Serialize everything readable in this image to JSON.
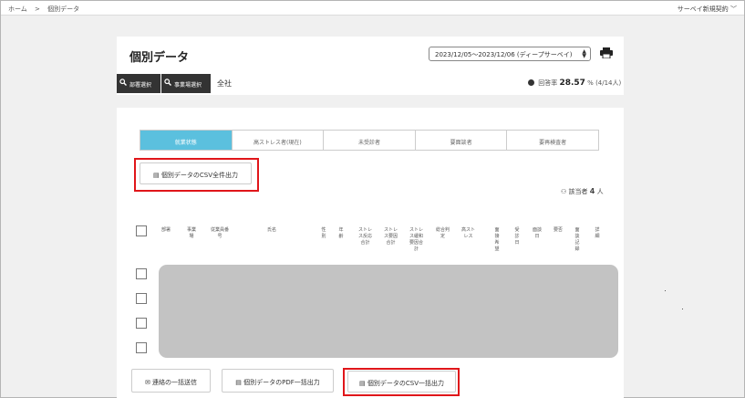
{
  "breadcrumb": [
    "ホーム",
    ">",
    "個別データ"
  ],
  "topbar": {
    "right_link": "サーベイ新規契約",
    "chevron": "chevron-down-icon"
  },
  "header": {
    "title": "個別データ",
    "period": "2023/12/05〜2023/12/06 (ディープサーベイ)",
    "print_icon": "printer-icon"
  },
  "filters": {
    "dept_button": "部署選択",
    "site_button": "事業場選択",
    "scope": "全社",
    "rate_label": "回答率",
    "rate_value": "28.57",
    "rate_unit": "%",
    "rate_detail": "(4/14人)"
  },
  "tabs": [
    {
      "label": "就業状態",
      "active": true
    },
    {
      "label": "高ストレス者(現在)",
      "active": false
    },
    {
      "label": "未受診者",
      "active": false
    },
    {
      "label": "要面談者",
      "active": false
    },
    {
      "label": "要再検査者",
      "active": false
    }
  ],
  "csv_all_button": "個別データのCSV全件出力",
  "count": {
    "label": "該当者",
    "value": "4",
    "unit": "人"
  },
  "table_headers": [
    "部署",
    "事業場",
    "従業員番号",
    "氏名",
    "性別",
    "年齢",
    "ストレス反応合計",
    "ストレス要因合計",
    "ストレス緩和要因合計",
    "総合判定",
    "高ストレス",
    "面接希望",
    "受診日",
    "面談日",
    "要否",
    "面談記録",
    "詳細"
  ],
  "bottom_buttons": {
    "contact": "連絡の一括送信",
    "pdf": "個別データのPDF一括出力",
    "csv": "個別データのCSV一括出力"
  },
  "colors": {
    "accent": "#5bc0de",
    "highlight": "#e0161a",
    "dark": "#333333"
  }
}
